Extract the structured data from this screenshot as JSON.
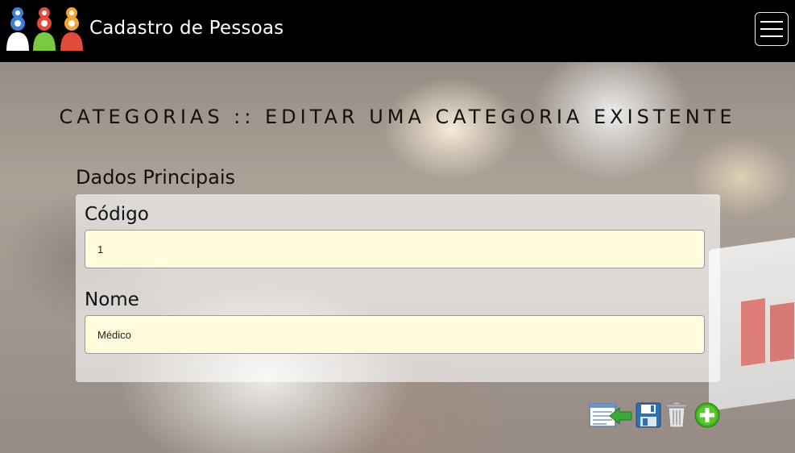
{
  "navbar": {
    "brand": "Cadastro de Pessoas",
    "menu_icon": "hamburger-menu-icon",
    "logo_icon": "people-group-icon"
  },
  "page": {
    "title": "CATEGORIAS :: EDITAR UMA CATEGORIA EXISTENTE"
  },
  "form": {
    "section_title": "Dados Principais",
    "fields": [
      {
        "label": "Código",
        "value": "1"
      },
      {
        "label": "Nome",
        "value": "Médico"
      }
    ]
  },
  "actions": [
    {
      "name": "back-to-list",
      "icon": "list-back-arrow-icon",
      "accent": "#3aa83a"
    },
    {
      "name": "save",
      "icon": "floppy-disk-icon",
      "accent": "#2f6fb5"
    },
    {
      "name": "delete",
      "icon": "trash-icon",
      "accent": "#9e9e9e"
    },
    {
      "name": "add",
      "icon": "plus-circle-icon",
      "accent": "#3fb21f"
    }
  ],
  "colors": {
    "navbar_bg": "#000000",
    "field_bg": "#fffbdc"
  }
}
